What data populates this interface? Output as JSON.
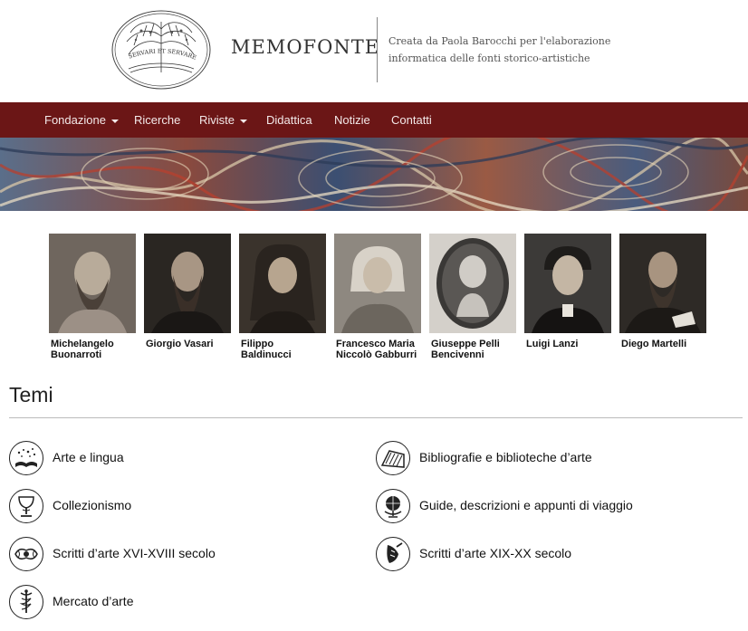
{
  "site": {
    "brand": "MEMOFONTE",
    "tagline": "Creata da Paola Barocchi per l'elaborazione informatica delle fonti storico-artistiche",
    "logo_motto": "SERVARI ET SERVARE MEUM EST"
  },
  "nav": {
    "items": [
      {
        "label": "Fondazione",
        "dropdown": true
      },
      {
        "label": "Ricerche",
        "dropdown": false
      },
      {
        "label": "Riviste",
        "dropdown": true
      },
      {
        "label": "Didattica",
        "dropdown": false
      },
      {
        "label": "Notizie",
        "dropdown": false
      },
      {
        "label": "Contatti",
        "dropdown": false
      }
    ]
  },
  "portraits": [
    {
      "line1": "Michelangelo",
      "line2": "Buonarroti"
    },
    {
      "line1": "Giorgio Vasari",
      "line2": ""
    },
    {
      "line1": "Filippo Baldinucci",
      "line2": ""
    },
    {
      "line1": "Francesco Maria",
      "line2": "Niccolò Gabburri"
    },
    {
      "line1": "Giuseppe Pelli",
      "line2": "Bencivenni"
    },
    {
      "line1": "Luigi Lanzi",
      "line2": ""
    },
    {
      "line1": "Diego Martelli",
      "line2": ""
    }
  ],
  "temi": {
    "title": "Temi",
    "items": [
      {
        "label": "Arte e lingua",
        "icon": "book-stars-icon"
      },
      {
        "label": "Bibliografie e biblioteche d’arte",
        "icon": "books-icon"
      },
      {
        "label": "Collezionismo",
        "icon": "chalice-icon"
      },
      {
        "label": "Guide, descrizioni e appunti di viaggio",
        "icon": "globe-icon"
      },
      {
        "label": "Scritti d’arte XVI-XVIII secolo",
        "icon": "ornament-icon"
      },
      {
        "label": "Scritti d’arte XIX-XX secolo",
        "icon": "hand-pen-icon"
      },
      {
        "label": "Mercato d’arte",
        "icon": "caduceus-icon"
      }
    ]
  },
  "colors": {
    "nav_bg": "#6b1616",
    "nav_text": "#f3e9e9"
  }
}
